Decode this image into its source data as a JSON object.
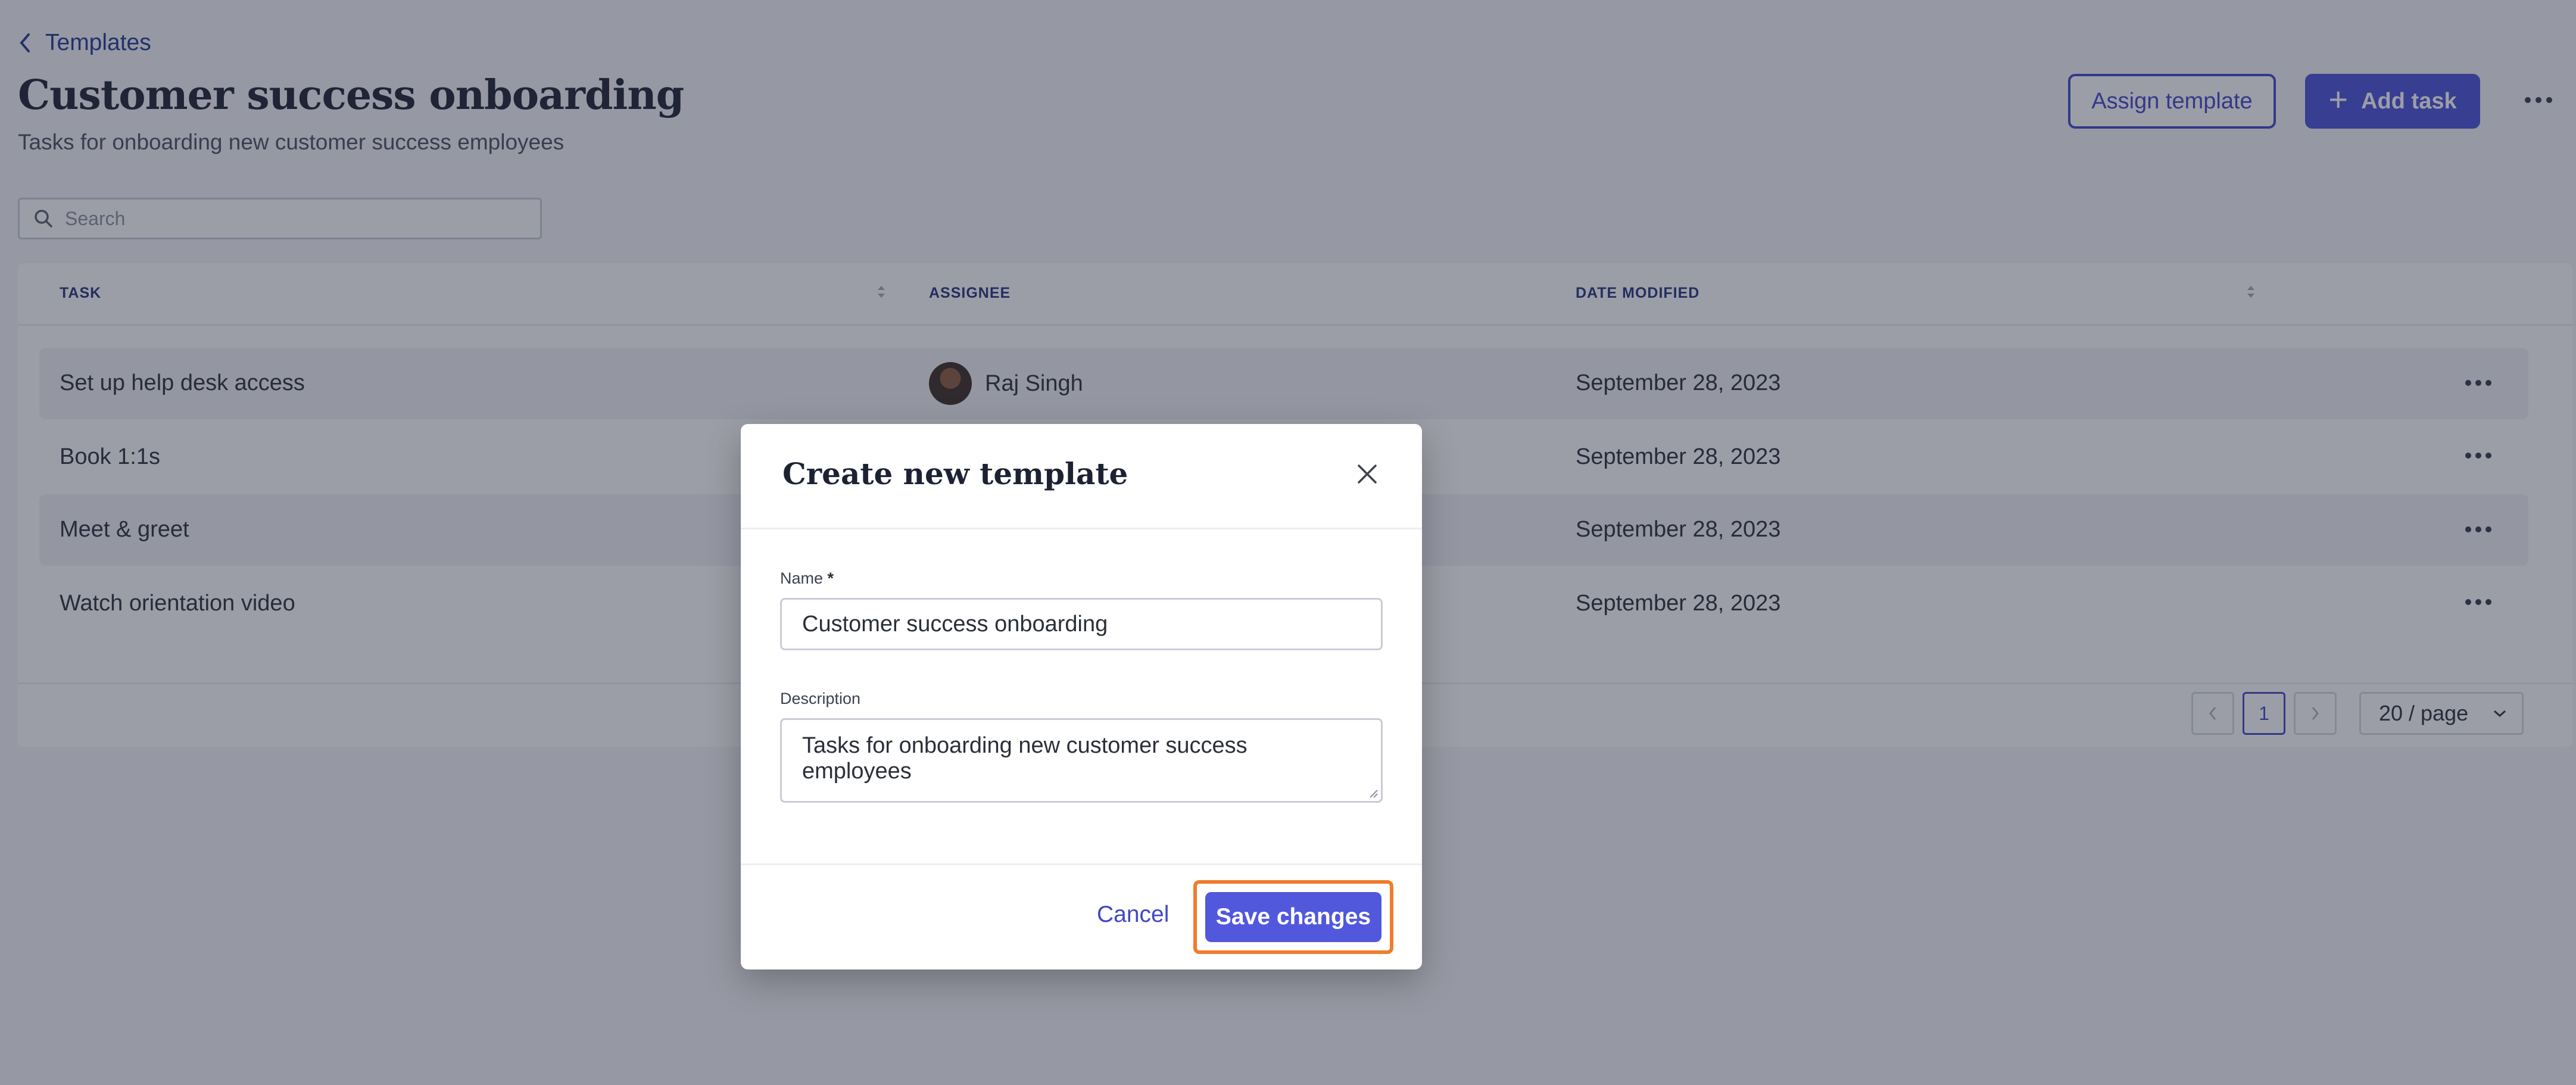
{
  "header": {
    "back_label": "Templates",
    "title": "Customer success onboarding",
    "subtitle": "Tasks for onboarding new customer success employees",
    "assign_template_label": "Assign template",
    "add_task_label": "Add task"
  },
  "search": {
    "placeholder": "Search"
  },
  "table": {
    "columns": {
      "task": "TASK",
      "assignee": "ASSIGNEE",
      "date_modified": "DATE MODIFIED"
    },
    "rows": [
      {
        "task": "Set up help desk access",
        "assignee": "Raj Singh",
        "date": "September 28, 2023"
      },
      {
        "task": "Book 1:1s",
        "assignee": "",
        "date": "September 28, 2023"
      },
      {
        "task": "Meet & greet",
        "assignee": "",
        "date": "September 28, 2023"
      },
      {
        "task": "Watch orientation video",
        "assignee": "",
        "date": "September 28, 2023"
      }
    ]
  },
  "pagination": {
    "current_page": "1",
    "page_size": "20 / page"
  },
  "modal": {
    "title": "Create new template",
    "name_label": "Name",
    "name_required_mark": "*",
    "name_value": "Customer success onboarding",
    "description_label": "Description",
    "description_value": "Tasks for onboarding new customer success employees",
    "cancel_label": "Cancel",
    "save_label": "Save changes"
  },
  "colors": {
    "accent": "#4a50d8",
    "highlight_outline": "#f07c2c",
    "overlay": "rgba(35,40,60,0.45)"
  },
  "icons": [
    "chevron-left-icon",
    "plus-icon",
    "more-horizontal-icon",
    "search-icon",
    "sort-icon",
    "close-icon",
    "chevron-down-icon",
    "chevron-right-icon",
    "resize-handle-icon"
  ]
}
